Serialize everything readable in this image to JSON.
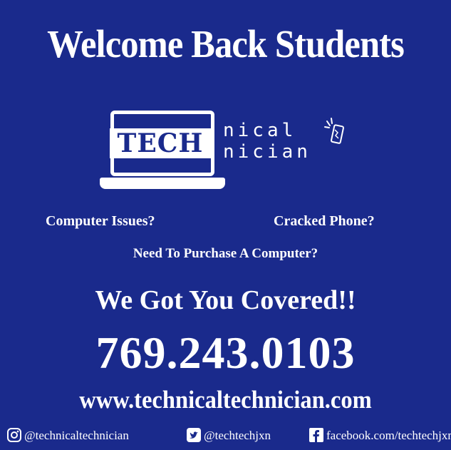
{
  "headline": "Welcome Back Students",
  "logo": {
    "tech": "TECH",
    "nical": "nical",
    "nician": "nician"
  },
  "questions": {
    "computer": "Computer Issues?",
    "phone": "Cracked Phone?",
    "purchase": "Need To Purchase A Computer?"
  },
  "tagline": "We Got You Covered!!",
  "phone_number": "769.243.0103",
  "website": "www.technicaltechnician.com",
  "social": {
    "instagram": "@technicaltechnician",
    "twitter": "@techtechjxn",
    "facebook": "facebook.com/techtechjxn"
  },
  "colors": {
    "background": "#1a2a8c",
    "text": "#ffffff"
  }
}
